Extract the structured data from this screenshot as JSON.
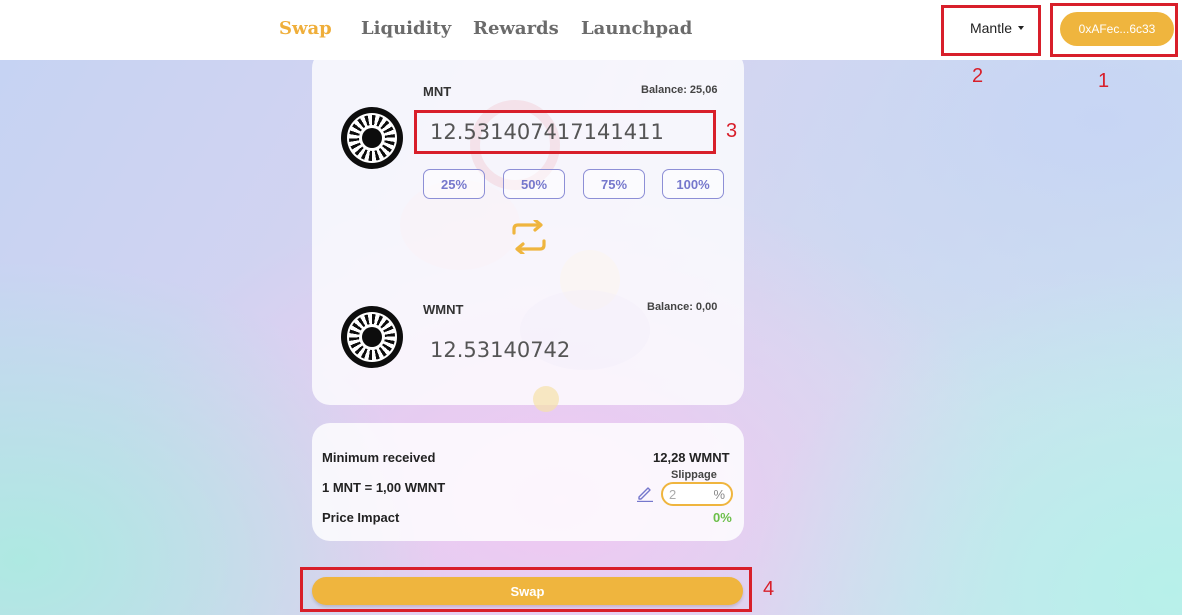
{
  "nav": {
    "links": [
      "Swap",
      "Liquidity",
      "Rewards",
      "Launchpad"
    ],
    "network": "Mantle",
    "wallet": "0xAFec...6c33"
  },
  "from": {
    "token": "MNT",
    "balance": "Balance: 25,06",
    "amount": "12.531407417141411",
    "percent_buttons": [
      "25%",
      "50%",
      "75%",
      "100%"
    ]
  },
  "to": {
    "token": "WMNT",
    "balance": "Balance: 0,00",
    "amount": "12.53140742"
  },
  "details": {
    "min_received_label": "Minimum received",
    "min_received_value": "12,28 WMNT",
    "rate": "1 MNT = 1,00 WMNT",
    "slippage_label": "Slippage",
    "slippage_value": "2",
    "slippage_unit": "%",
    "impact_label": "Price Impact",
    "impact_value": "0%"
  },
  "swap_button": "Swap",
  "annotations": [
    "1",
    "2",
    "3",
    "4"
  ],
  "colors": {
    "accent": "#efb53e",
    "active_nav": "#efae3a",
    "percent_button": "#7577cc",
    "annotation": "#d81f2a",
    "impact_positive": "#6cbf4a"
  }
}
